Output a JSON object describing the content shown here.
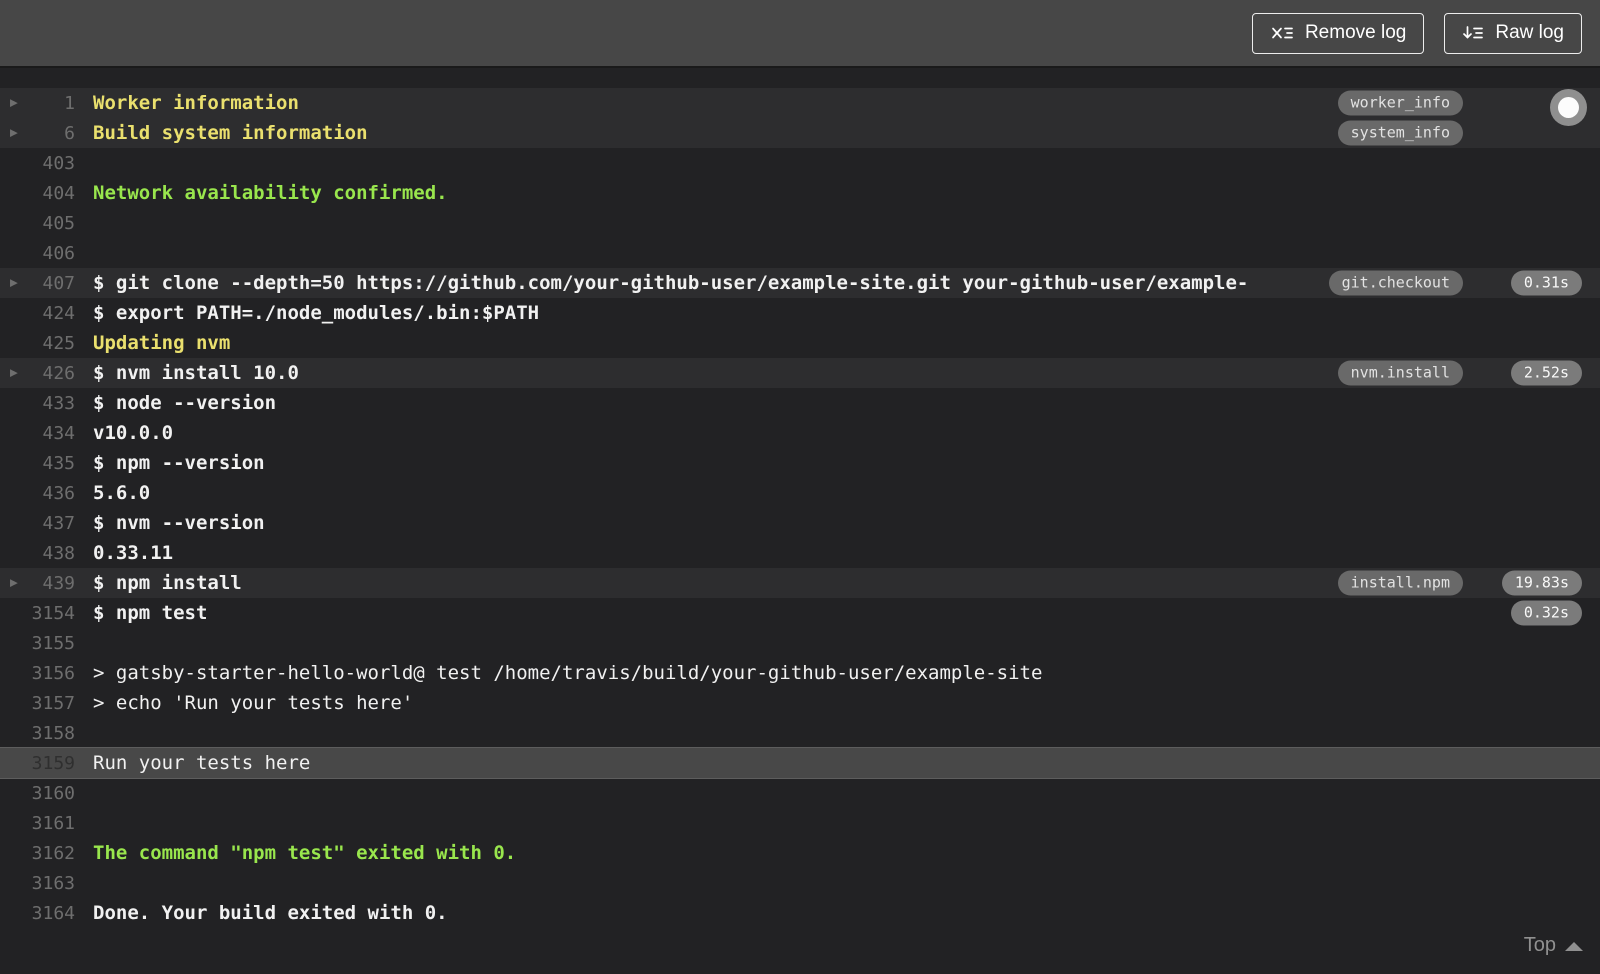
{
  "toolbar": {
    "remove_log_label": "Remove log",
    "raw_log_label": "Raw log",
    "icons": {
      "remove_log": "clear-list-x-icon",
      "raw_log": "download-list-icon"
    }
  },
  "footer": {
    "top_label": "Top",
    "icon": "caret-up-icon"
  },
  "follow_button": {
    "icon": "record-circle-icon"
  },
  "colors": {
    "toolbar_bg": "#474747",
    "log_bg": "#222224",
    "fold_row_bg": "#2d2d2f",
    "selected_row_bg": "#484848",
    "text": "#f1f1f1",
    "line_number": "#6e6e6e",
    "section_yellow": "#eae06e",
    "notice_green": "#99e64d",
    "fold_tag_bg": "#696969",
    "duration_badge_bg": "#7b7b7b"
  },
  "log": {
    "rows": [
      {
        "num": "1",
        "text": "Worker information",
        "style": "yellow",
        "fold": true,
        "highlight": true,
        "tag": "worker_info"
      },
      {
        "num": "6",
        "text": "Build system information",
        "style": "yellow",
        "fold": true,
        "highlight": true,
        "tag": "system_info"
      },
      {
        "num": "403",
        "text": ""
      },
      {
        "num": "404",
        "text": "Network availability confirmed.",
        "style": "green"
      },
      {
        "num": "405",
        "text": ""
      },
      {
        "num": "406",
        "text": ""
      },
      {
        "num": "407",
        "text": "$ git clone --depth=50 https://github.com/your-github-user/example-site.git your-github-user/example-",
        "bold": true,
        "fold": true,
        "highlight": true,
        "tag": "git.checkout",
        "duration": "0.31s"
      },
      {
        "num": "424",
        "text": "$ export PATH=./node_modules/.bin:$PATH",
        "bold": true
      },
      {
        "num": "425",
        "text": "Updating nvm",
        "style": "yellow"
      },
      {
        "num": "426",
        "text": "$ nvm install 10.0",
        "bold": true,
        "fold": true,
        "highlight": true,
        "tag": "nvm.install",
        "duration": "2.52s"
      },
      {
        "num": "433",
        "text": "$ node --version",
        "bold": true
      },
      {
        "num": "434",
        "text": "v10.0.0",
        "bold": true
      },
      {
        "num": "435",
        "text": "$ npm --version",
        "bold": true
      },
      {
        "num": "436",
        "text": "5.6.0",
        "bold": true
      },
      {
        "num": "437",
        "text": "$ nvm --version",
        "bold": true
      },
      {
        "num": "438",
        "text": "0.33.11",
        "bold": true
      },
      {
        "num": "439",
        "text": "$ npm install",
        "bold": true,
        "fold": true,
        "highlight": true,
        "tag": "install.npm",
        "duration": "19.83s"
      },
      {
        "num": "3154",
        "text": "$ npm test",
        "bold": true,
        "duration": "0.32s"
      },
      {
        "num": "3155",
        "text": ""
      },
      {
        "num": "3156",
        "text": "> gatsby-starter-hello-world@ test /home/travis/build/your-github-user/example-site"
      },
      {
        "num": "3157",
        "text": "> echo 'Run your tests here'"
      },
      {
        "num": "3158",
        "text": ""
      },
      {
        "num": "3159",
        "text": "Run your tests here",
        "selected": true
      },
      {
        "num": "3160",
        "text": ""
      },
      {
        "num": "3161",
        "text": ""
      },
      {
        "num": "3162",
        "text": "The command \"npm test\" exited with 0.",
        "style": "green"
      },
      {
        "num": "3163",
        "text": ""
      },
      {
        "num": "3164",
        "text": "Done. Your build exited with 0.",
        "bold": true
      }
    ]
  }
}
